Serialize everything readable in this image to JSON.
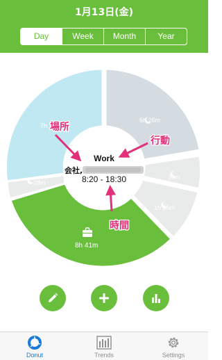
{
  "header": {
    "title": "1月13日(金)"
  },
  "segments": {
    "day": "Day",
    "week": "Week",
    "month": "Month",
    "year": "Year",
    "active": "Day"
  },
  "donut": {
    "slices": [
      {
        "id": "blue",
        "color": "#bfe8f2",
        "label": "7h"
      },
      {
        "id": "grey-large",
        "color": "#d4dbe1",
        "label": "6h 26m"
      },
      {
        "id": "grey-small",
        "color": "#e9eaea",
        "label": "30m"
      },
      {
        "id": "grey-medium",
        "color": "#e9eaea",
        "label": "1h 25m"
      },
      {
        "id": "work",
        "color": "#69bf3c",
        "label": "8h 41m"
      },
      {
        "id": "grey-left",
        "color": "#e9eaea",
        "label": "28m"
      }
    ],
    "center": {
      "activity": "Work",
      "place": "会社,",
      "time": "8:20 - 18:30"
    },
    "annotations": {
      "place": "場所",
      "activity": "行動",
      "time": "時間",
      "color": "#e2317a"
    }
  },
  "tabs": {
    "donut": "Donut",
    "trends": "Trends",
    "settings": "Settings",
    "active": "Donut"
  },
  "colors": {
    "accent": "#69bf3c",
    "tab_active": "#1a7ad9",
    "tab_inactive": "#8e8e8e"
  }
}
